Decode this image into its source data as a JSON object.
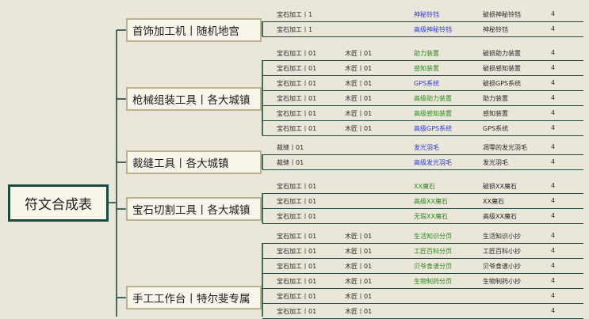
{
  "root": {
    "label": "符文合成表"
  },
  "colors": {
    "line": "#1d4a40",
    "green": "#2e8b1f",
    "blue": "#2a3bd9"
  },
  "categories": [
    {
      "label": "首饰加工机丨随机地宫",
      "rows": [
        {
          "a": "宝石加工丨1",
          "b": "",
          "name": "神秘铃铛",
          "name_color": "#2a3bd9",
          "mat": "破损神秘铃铛",
          "n": "4"
        },
        {
          "a": "宝石加工丨1",
          "b": "",
          "name": "高级神秘铃铛",
          "name_color": "#2a3bd9",
          "mat": "神秘铃铛",
          "n": "4"
        }
      ]
    },
    {
      "label": "枪械组装工具丨各大城镇",
      "rows": [
        {
          "a": "宝石加工丨01",
          "b": "木匠丨01",
          "name": "助力装置",
          "name_color": "#2e8b1f",
          "mat": "破损助力装置",
          "n": "4"
        },
        {
          "a": "宝石加工丨01",
          "b": "木匠丨01",
          "name": "感知装置",
          "name_color": "#2e8b1f",
          "mat": "破损感知装置",
          "n": "4"
        },
        {
          "a": "宝石加工丨01",
          "b": "木匠丨01",
          "name": "GPS系统",
          "name_color": "#2a3bd9",
          "mat": "破损GPS系统",
          "n": "4"
        },
        {
          "a": "宝石加工丨01",
          "b": "木匠丨01",
          "name": "高级助力装置",
          "name_color": "#2e8b1f",
          "mat": "助力装置",
          "n": "4"
        },
        {
          "a": "宝石加工丨01",
          "b": "木匠丨01",
          "name": "高级感知装置",
          "name_color": "#2e8b1f",
          "mat": "感知装置",
          "n": "4"
        },
        {
          "a": "宝石加工丨01",
          "b": "木匠丨01",
          "name": "高级GPS系统",
          "name_color": "#2a3bd9",
          "mat": "GPS系统",
          "n": "4"
        }
      ]
    },
    {
      "label": "裁缝工具丨各大城镇",
      "rows": [
        {
          "a": "裁缝丨01",
          "b": "",
          "name": "发光羽毛",
          "name_color": "#2a3bd9",
          "mat": "凋零的发光羽毛",
          "n": "4"
        },
        {
          "a": "裁缝丨01",
          "b": "",
          "name": "高级发光羽毛",
          "name_color": "#2a3bd9",
          "mat": "发光羽毛",
          "n": "4"
        }
      ]
    },
    {
      "label": "宝石切割工具丨各大城镇",
      "rows": [
        {
          "a": "宝石加工丨01",
          "b": "",
          "name": "XX魔石",
          "name_color": "#2e8b1f",
          "mat": "破损XX魔石",
          "n": "4"
        },
        {
          "a": "宝石加工丨01",
          "b": "",
          "name": "高级XX魔石",
          "name_color": "#2e8b1f",
          "mat": "XX魔石",
          "n": "4"
        },
        {
          "a": "宝石加工丨01",
          "b": "",
          "name": "无瑕XX魔石",
          "name_color": "#2e8b1f",
          "mat": "高级XX魔石",
          "n": "4"
        }
      ]
    },
    {
      "label": "手工工作台丨特尔斐专属",
      "rows": [
        {
          "a": "宝石加工丨01",
          "b": "木匠丨01",
          "name": "生活知识分页",
          "name_color": "#2e8b1f",
          "mat": "生活知识小抄",
          "n": "4"
        },
        {
          "a": "宝石加工丨01",
          "b": "木匠丨01",
          "name": "工匠百科分页",
          "name_color": "#2e8b1f",
          "mat": "工匠百科小抄",
          "n": "4"
        },
        {
          "a": "宝石加工丨01",
          "b": "木匠丨01",
          "name": "贝爷食谱分页",
          "name_color": "#2e8b1f",
          "mat": "贝爷食谱小抄",
          "n": "4"
        },
        {
          "a": "宝石加工丨01",
          "b": "木匠丨01",
          "name": "生物制药分页",
          "name_color": "#2e8b1f",
          "mat": "生物制药小抄",
          "n": "4"
        },
        {
          "a": "宝石加工丨01",
          "b": "木匠丨01",
          "name": "",
          "name_color": "#2e8b1f",
          "mat": "",
          "n": "4"
        },
        {
          "a": "宝石加工丨01",
          "b": "木匠丨01",
          "name": "",
          "name_color": "#2e8b1f",
          "mat": "",
          "n": "4"
        }
      ]
    }
  ]
}
